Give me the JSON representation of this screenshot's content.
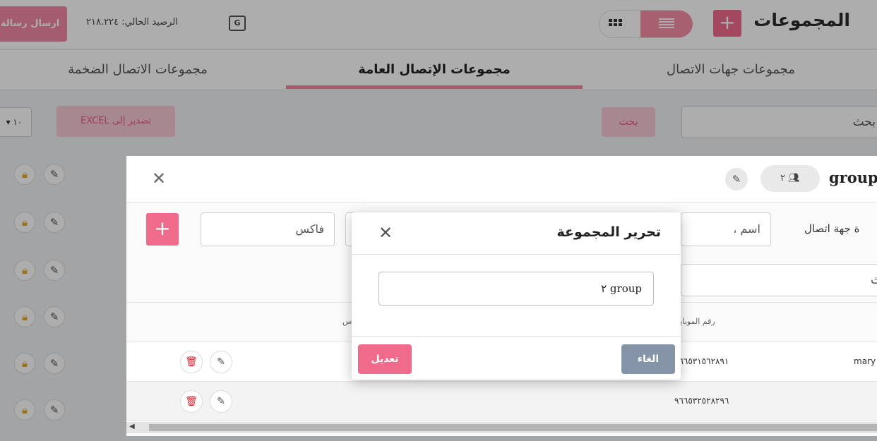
{
  "header": {
    "title": "المجموعات",
    "add_label": "+",
    "balance": "الرصيد الحالي: ٢١٨.٢٢٤",
    "send_label": "ارسال رسالة",
    "translate_label": "G"
  },
  "tabs": [
    {
      "label": "مجموعات جهات الاتصال"
    },
    {
      "label": "مجموعات الإتصال العامة"
    },
    {
      "label": "مجموعات الاتصال الضخمة"
    }
  ],
  "toolbar": {
    "search_placeholder": "بحث",
    "search_button": "بحث",
    "export_button": "تصدير إلى EXCEL",
    "per_page": "١٠"
  },
  "panel": {
    "title": "group",
    "member_count": "٢",
    "add_contact_label": "ة جهة اتصال",
    "name_placeholder": "اسم ،",
    "fax_placeholder": "فاكس",
    "search_placeholder": "ث",
    "columns": {
      "mobile": "رقم الموبايل",
      "fax": "س"
    },
    "rows": [
      {
        "name": "mary",
        "mobile": "٩٦٦٥٣١٥٦٢٨٩١"
      },
      {
        "name": "",
        "mobile": "٩٦٦٥٣٢٥٢٨٢٩٦"
      }
    ]
  },
  "modal": {
    "title": "تحرير المجموعة",
    "input_value": "group ٢",
    "edit_button": "تعديل",
    "cancel_button": "الغاء"
  },
  "colors": {
    "accent": "#f06a8b",
    "cancel": "#8494a6",
    "danger": "#e0202a",
    "lock": "#e6a81f"
  }
}
